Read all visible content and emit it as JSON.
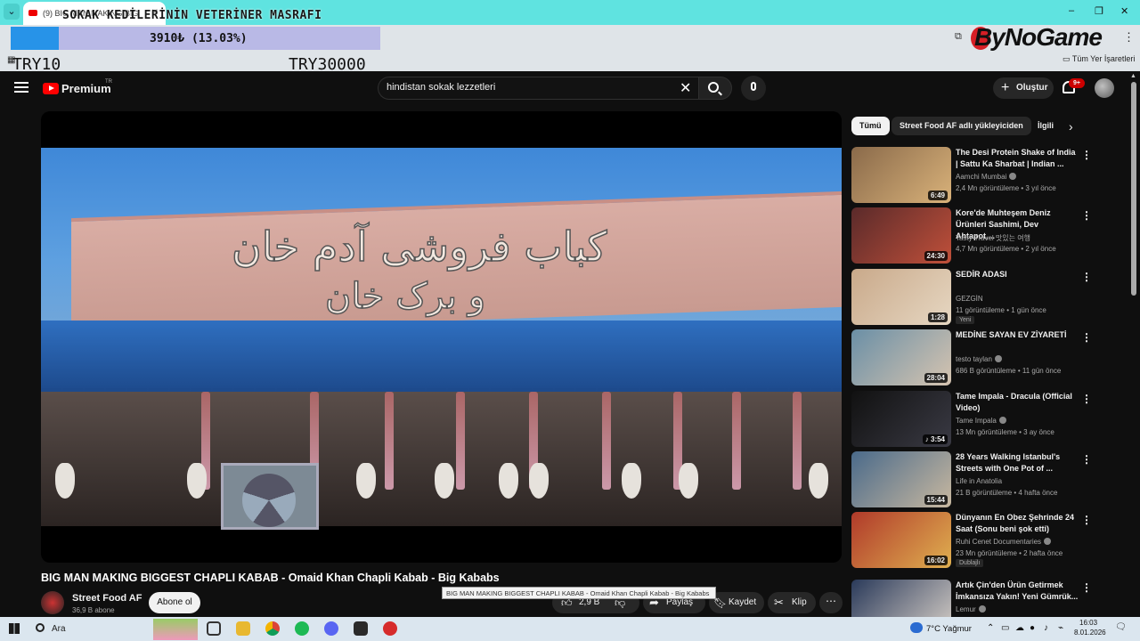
{
  "browser": {
    "tab_title": "(9) BIG MAN MAKING BIG",
    "close_glyph": "✕",
    "all_bookmarks": "Tüm Yer İşaretleri"
  },
  "overlay": {
    "donation_title": "SOKAK KEDİLERİNİN VETERİNER MASRAFI",
    "progress_text": "3910₺ (13.03%)",
    "progress_fraction": 0.1303,
    "goal_start": "TRY10",
    "goal_end": "TRY30000",
    "brand": "ByNoGame"
  },
  "youtube": {
    "brand": "Premium",
    "region": "TR",
    "search_value": "hindistan sokak lezzetleri",
    "create_label": "Oluştur",
    "notif_count": "9+"
  },
  "video": {
    "title": "BIG MAN MAKING BIGGEST CHAPLI KABAB - Omaid Khan Chapli Kabab - Big Kababs",
    "tooltip": "BIG MAN MAKING BIGGEST CHAPLI KABAB - Omaid Khan Chapli Kabab - Big Kababs",
    "sign_line1": "کباب فروشی آدم خان",
    "sign_line2": "و برک خان",
    "channel_name": "Street Food AF",
    "channel_subs": "36,9 B abone",
    "subscribe_label": "Abone ol",
    "like_count": "2,9 B",
    "share_label": "Paylaş",
    "save_label": "Kaydet",
    "clip_label": "Klip"
  },
  "chips": [
    "Tümü",
    "Street Food AF adlı yükleyiciden",
    "İlgili"
  ],
  "recommendations": [
    {
      "title": "The Desi Protein Shake of India | Sattu Ka Sharbat | Indian ...",
      "channel": "Aamchi Mumbai",
      "verified": true,
      "meta": "2,4 Mn görüntüleme • 3 yıl önce",
      "duration": "6:49",
      "badge": "",
      "thumb_a": "#8a6a4a",
      "thumb_b": "#d9b27a"
    },
    {
      "title": "Kore'de Muhteşem Deniz Ürünleri Sashimi, Dev Ahtapot,...",
      "channel": "Tasty Travel 맛있는 여행",
      "verified": false,
      "meta": "4,7 Mn görüntüleme • 2 yıl önce",
      "duration": "24:30",
      "badge": "",
      "thumb_a": "#5a2a2a",
      "thumb_b": "#c0503a"
    },
    {
      "title": "SEDİR ADASI",
      "channel": "GEZGİN",
      "verified": false,
      "meta": "11 görüntüleme • 1 gün önce",
      "duration": "1:28",
      "badge": "Yeni",
      "thumb_a": "#c9a98a",
      "thumb_b": "#e6d7c2"
    },
    {
      "title": "MEDİNE SAYAN EV ZİYARETİ",
      "channel": "testo taylan",
      "verified": true,
      "meta": "686 B görüntüleme • 11 gün önce",
      "duration": "28:04",
      "badge": "",
      "thumb_a": "#6a8fa6",
      "thumb_b": "#d6c4b0"
    },
    {
      "title": "Tame Impala - Dracula (Official Video)",
      "channel": "Tame Impala",
      "verified": true,
      "meta": "13 Mn görüntüleme • 3 ay önce",
      "duration": "♪ 3:54",
      "badge": "",
      "thumb_a": "#111111",
      "thumb_b": "#3a3a44"
    },
    {
      "title": "28 Years Walking Istanbul's Streets with One Pot of ...",
      "channel": "Life in Anatolia",
      "verified": false,
      "meta": "21 B görüntüleme • 4 hafta önce",
      "duration": "15:44",
      "badge": "",
      "thumb_a": "#4a6a8a",
      "thumb_b": "#c8b8a0"
    },
    {
      "title": "Dünyanın En Obez Şehrinde 24 Saat (Sonu beni şok etti)",
      "channel": "Ruhi Cenet Documentaries",
      "verified": true,
      "meta": "23 Mn görüntüleme • 2 hafta önce",
      "duration": "16:02",
      "badge": "Dublajlı",
      "thumb_a": "#b03a2a",
      "thumb_b": "#e0b050"
    },
    {
      "title": "Artık Çin'den Ürün Getirmek İmkansıza Yakın! Yeni Gümrük...",
      "channel": "Lemur",
      "verified": true,
      "meta": "",
      "duration": "",
      "badge": "",
      "thumb_a": "#2a3a5a",
      "thumb_b": "#d8d0c8"
    }
  ],
  "taskbar": {
    "search_label": "Ara",
    "weather": "7°C  Yağmur",
    "time": "16:03",
    "date": "8.01.2026"
  }
}
